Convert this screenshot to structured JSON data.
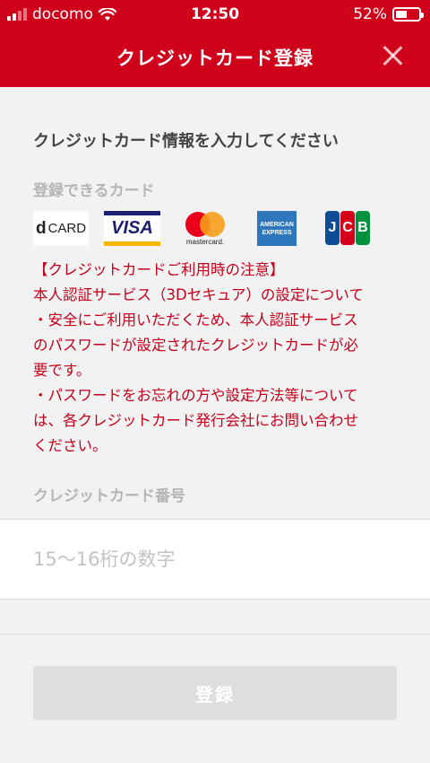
{
  "status_bar": {
    "carrier": "docomo",
    "time": "12:50",
    "battery": "52%",
    "battery_level": 0.52
  },
  "header": {
    "title": "クレジットカード登録",
    "close_icon": "close-icon"
  },
  "form": {
    "section_title": "クレジットカード情報を入力してください",
    "cards_label": "登録できるカード",
    "brands": {
      "dcard": {
        "prefix": "d",
        "text": "CARD"
      },
      "visa": "VISA",
      "mastercard": "mastercard.",
      "amex": {
        "line1": "AMERICAN",
        "line2": "EXPRESS"
      },
      "jcb": [
        "J",
        "C",
        "B"
      ]
    },
    "notice": [
      "【クレジットカードご利用時の注意】",
      "本人認証サービス（3Dセキュア）の設定について",
      "・安全にご利用いただくため、本人認証サービス",
      "のパスワードが設定されたクレジットカードが必",
      "要です。",
      "・パスワードをお忘れの方や設定方法等について",
      "は、各クレジットカード発行会社にお問い合わせ",
      "ください。"
    ],
    "number_label": "クレジットカード番号",
    "number_value": "",
    "number_placeholder": "15〜16桁の数字",
    "submit_label": "登録"
  },
  "colors": {
    "brand": "#d0021b",
    "notice": "#c6001a",
    "disabled_button": "#dedede"
  }
}
